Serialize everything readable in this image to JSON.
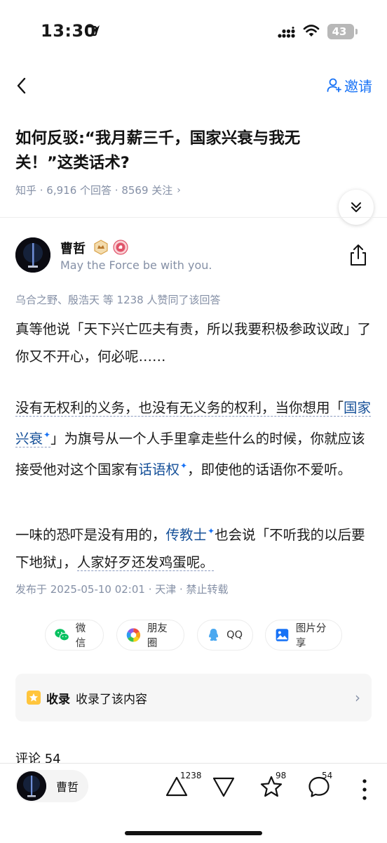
{
  "status_bar": {
    "time": "13:30",
    "battery": "43",
    "icons": [
      "location-arrow-icon",
      "cellular-signal-icon",
      "wifi-icon",
      "battery-icon"
    ]
  },
  "nav": {
    "back_icon": "chevron-left-icon",
    "invite_label": "邀请",
    "invite_icon": "person-add-icon"
  },
  "question": {
    "title": "如何反驳:“我月薪三千，国家兴衰与我无关！”这类话术?",
    "meta": "知乎 · 6,916 个回答 · 8569 关注",
    "meta_chevron": "›"
  },
  "author": {
    "name": "曹哲",
    "bio": "May the Force be with you.",
    "badges": [
      "creator-badge-icon",
      "like-badge-icon"
    ]
  },
  "upvote_line": "乌合之野、殷浩天 等 1238 人赞同了该回答",
  "answer": {
    "p1": "真等他说「天下兴亡匹夫有责，所以我要积极参政议政」了你又不开心，何必呢……",
    "p2_prefix": "没有无权利的义务，也没有无义务的权利，当你想用「",
    "p2_kw1": "国家兴衰",
    "p2_mid": "」为旗号从一个人手里拿走些什么的时候，你就应该接受他对这个国家有",
    "p2_kw2": "话语权",
    "p2_suffix": "，即使他的话语你不爱听。",
    "p3_prefix": "一味的恐吓是没有用的，",
    "p3_kw": "传教士",
    "p3_mid": "也会说「不听我的以后要下地狱」，",
    "p3_suffix": "人家好歹还发鸡蛋呢。",
    "sparkle": "✦"
  },
  "publish_line": "发布于 2025-05-10 02:01 · 天津 · 禁止转载",
  "share": {
    "wechat": "微信",
    "moments": "朋友圈",
    "qq": "QQ",
    "image": "图片分享"
  },
  "collection": {
    "label": "收录",
    "text": "收录了该内容",
    "chevron": "›"
  },
  "comments": {
    "heading": "评论 54"
  },
  "bottom_bar": {
    "author_name": "曹哲",
    "upvote_count": "1238",
    "favorite_count": "98",
    "comment_count": "54"
  },
  "colors": {
    "accent": "#1772f6",
    "keyword": "#175199",
    "meta_gray": "#8590a6",
    "collection_yellow": "#ffc53d"
  }
}
